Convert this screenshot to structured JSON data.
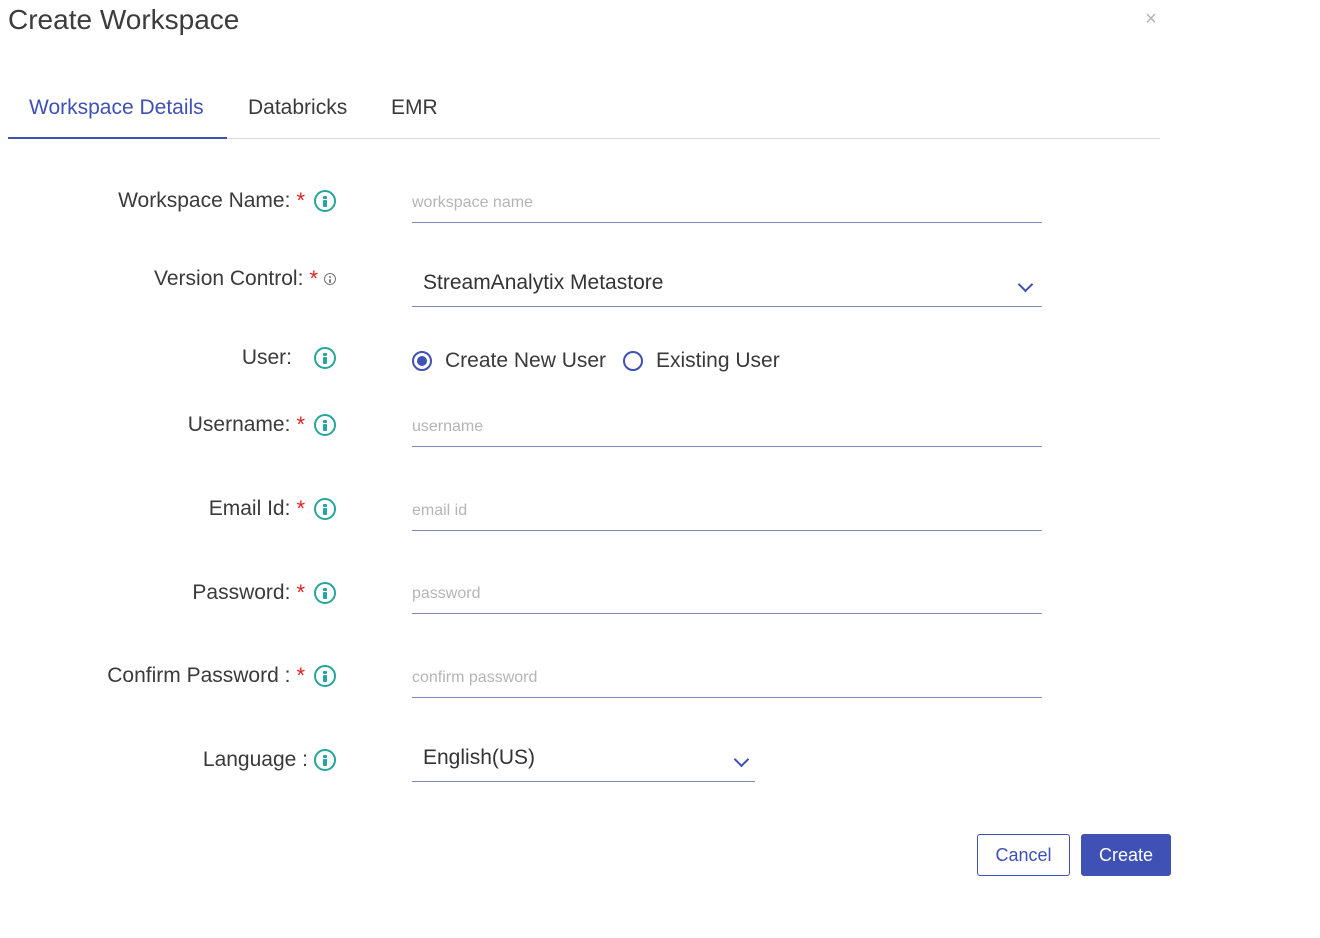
{
  "dialog": {
    "title": "Create Workspace",
    "close_glyph": "×"
  },
  "tabs": [
    {
      "label": "Workspace Details",
      "active": true
    },
    {
      "label": "Databricks",
      "active": false
    },
    {
      "label": "EMR",
      "active": false
    }
  ],
  "form": {
    "workspace_name": {
      "label": "Workspace Name:",
      "required": "*",
      "placeholder": "workspace name",
      "value": ""
    },
    "version_control": {
      "label": "Version Control:",
      "required": "*",
      "value": "StreamAnalytix Metastore"
    },
    "user": {
      "label": "User:",
      "options": [
        "Create New User",
        "Existing User"
      ],
      "selected": "Create New User"
    },
    "username": {
      "label": "Username:",
      "required": "*",
      "placeholder": "username",
      "value": ""
    },
    "email": {
      "label": "Email Id:",
      "required": "*",
      "placeholder": "email id",
      "value": ""
    },
    "password": {
      "label": "Password:",
      "required": "*",
      "placeholder": "password",
      "value": ""
    },
    "confirm_password": {
      "label": "Confirm Password :",
      "required": "*",
      "placeholder": "confirm password",
      "value": ""
    },
    "language": {
      "label": "Language :",
      "value": "English(US)"
    }
  },
  "buttons": {
    "cancel": "Cancel",
    "create": "Create"
  },
  "colors": {
    "accent": "#3f51b5",
    "info_icon": "#26a69a",
    "required": "#e02020"
  },
  "icons": [
    "info-icon",
    "close-icon",
    "chevron-down-icon",
    "radio-button"
  ]
}
